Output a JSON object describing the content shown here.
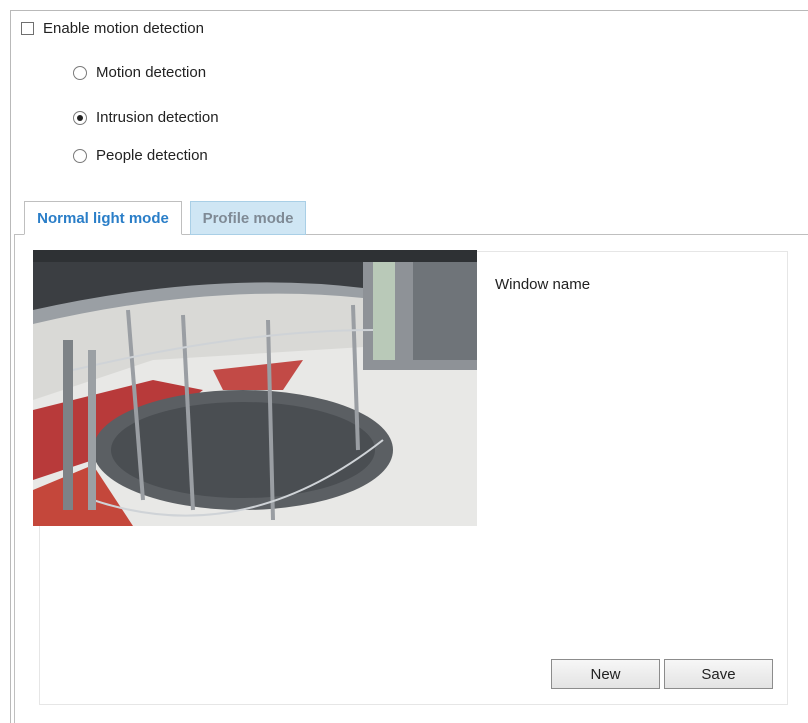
{
  "motion": {
    "enable_label": "Enable motion detection",
    "enable_checked": false,
    "options": [
      {
        "label": "Motion detection",
        "selected": false
      },
      {
        "label": "Intrusion detection",
        "selected": true
      },
      {
        "label": "People detection",
        "selected": false
      }
    ]
  },
  "tabs": [
    {
      "label": "Normal light mode",
      "active": true
    },
    {
      "label": "Profile mode",
      "active": false
    }
  ],
  "panel": {
    "window_name_label": "Window name",
    "new_label": "New",
    "save_label": "Save"
  },
  "colors": {
    "active_tab_text": "#2a7ec8",
    "inactive_tab_bg": "#cfe6f4"
  }
}
